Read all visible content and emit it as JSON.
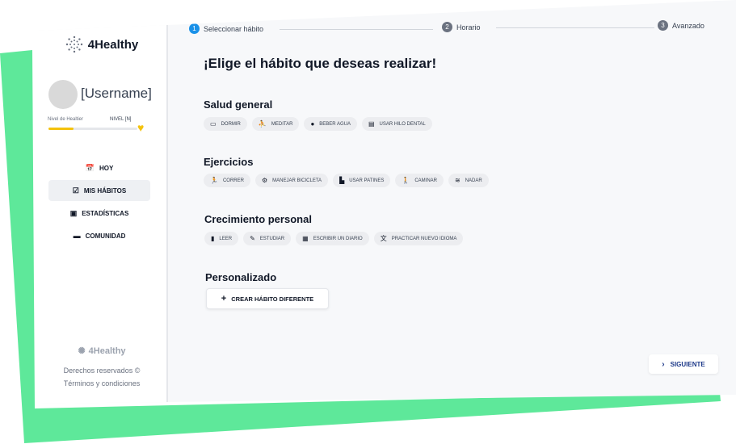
{
  "colors": {
    "accent_green": "#5ee89a",
    "step_active": "#1a91e8",
    "level_fill": "#f4c20d"
  },
  "sidebar": {
    "logo": {
      "icon": "dotted-circle-icon",
      "text": "4Healthy"
    },
    "username": "[Username]",
    "level_label": "Nivel de Healtier",
    "level_badge": "NIVEL [N]",
    "level_progress": 0.28,
    "nav": [
      {
        "label": "HOY",
        "icon": "calendar-icon"
      },
      {
        "label": "MIS HÁBITOS",
        "icon": "checklist-icon",
        "active": true
      },
      {
        "label": "ESTADÍSTICAS",
        "icon": "calendar-check-icon"
      },
      {
        "label": "COMUNIDAD",
        "icon": "chat-icon"
      }
    ],
    "footer": {
      "logo_text": "4Healthy",
      "rights": "Derechos reservados ©",
      "terms": "Términos y condiciones"
    }
  },
  "stepper": [
    {
      "num": "1",
      "label": "Seleccionar hábito"
    },
    {
      "num": "2",
      "label": "Horario"
    },
    {
      "num": "3",
      "label": "Avanzado"
    }
  ],
  "main": {
    "title": "¡Elige el hábito que deseas realizar!",
    "sections": [
      {
        "title": "Salud general",
        "chips": [
          {
            "label": "DORMIR",
            "icon": "bed-icon"
          },
          {
            "label": "MEDITAR",
            "icon": "meditation-icon"
          },
          {
            "label": "BEBER AGUA",
            "icon": "water-drop-icon"
          },
          {
            "label": "USAR HILO DENTAL",
            "icon": "floss-icon"
          }
        ]
      },
      {
        "title": "Ejercicios",
        "chips": [
          {
            "label": "CORRER",
            "icon": "running-icon"
          },
          {
            "label": "MANEJAR BICICLETA",
            "icon": "bicycle-icon"
          },
          {
            "label": "USAR PATINES",
            "icon": "roller-skate-icon"
          },
          {
            "label": "CAMINAR",
            "icon": "walking-icon"
          },
          {
            "label": "NADAR",
            "icon": "swimming-icon"
          }
        ]
      },
      {
        "title": "Crecimiento personal",
        "chips": [
          {
            "label": "LEER",
            "icon": "book-icon"
          },
          {
            "label": "ESTUDIAR",
            "icon": "school-icon"
          },
          {
            "label": "ESCRIBIR UN DIARIO",
            "icon": "journal-icon"
          },
          {
            "label": "PRACTICAR NUEVO IDIOMA",
            "icon": "translate-icon"
          }
        ]
      },
      {
        "title": "Personalizado"
      }
    ],
    "create_button": "CREAR HÁBITO DIFERENTE",
    "next_button": "SIGUIENTE"
  }
}
